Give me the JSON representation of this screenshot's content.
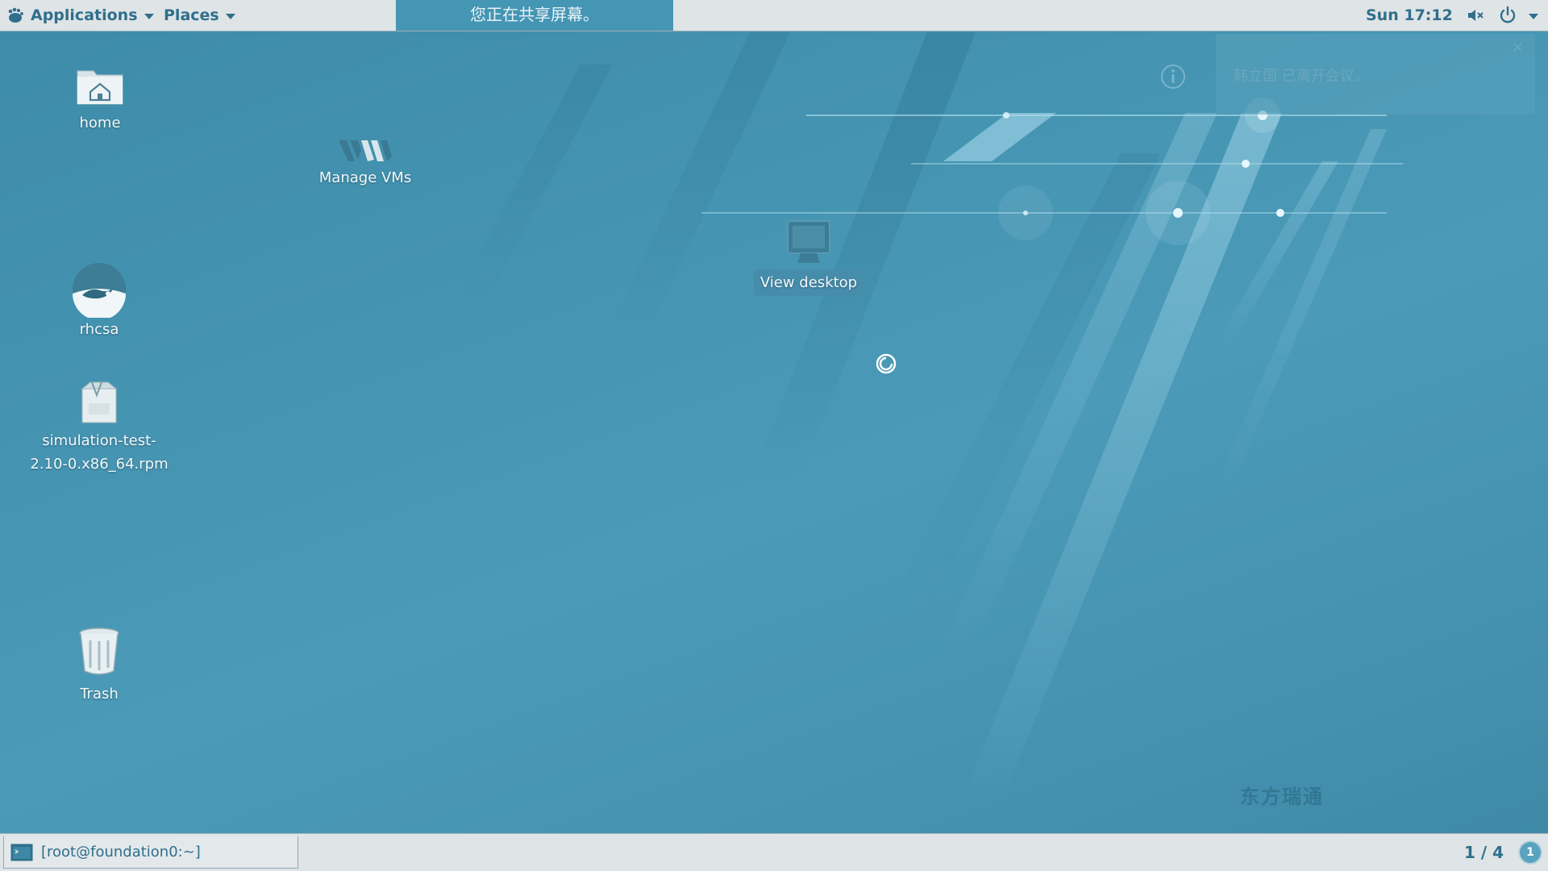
{
  "top_panel": {
    "applications_label": "Applications",
    "places_label": "Places",
    "share_banner": "您正在共享屏幕。",
    "clock": "Sun 17:12"
  },
  "notification": {
    "text": "韩立国 已离开会议。"
  },
  "desktop": {
    "icons": [
      {
        "label": "home",
        "icon": "home-folder-icon"
      },
      {
        "label": "Manage VMs",
        "icon": "virtual-machine-manager-icon"
      },
      {
        "label": "rhcsa",
        "icon": "rhcsa-disc-icon"
      },
      {
        "label_line1": "simulation-test-",
        "label_line2": "2.10-0.x86_64.rpm",
        "icon": "rpm-package-icon"
      },
      {
        "label": "Trash",
        "icon": "trash-icon"
      },
      {
        "label": "View desktop",
        "icon": "monitor-icon"
      }
    ],
    "watermark": "东方瑞通"
  },
  "bottom_panel": {
    "task_label": "[root@foundation0:~]",
    "workspace": "1 / 4"
  },
  "colors": {
    "panel_bg": "#dfe4e6",
    "panel_text": "#2f6f8c",
    "desktop_bg": "#4493b1",
    "share_banner_bg": "#4595b4"
  }
}
